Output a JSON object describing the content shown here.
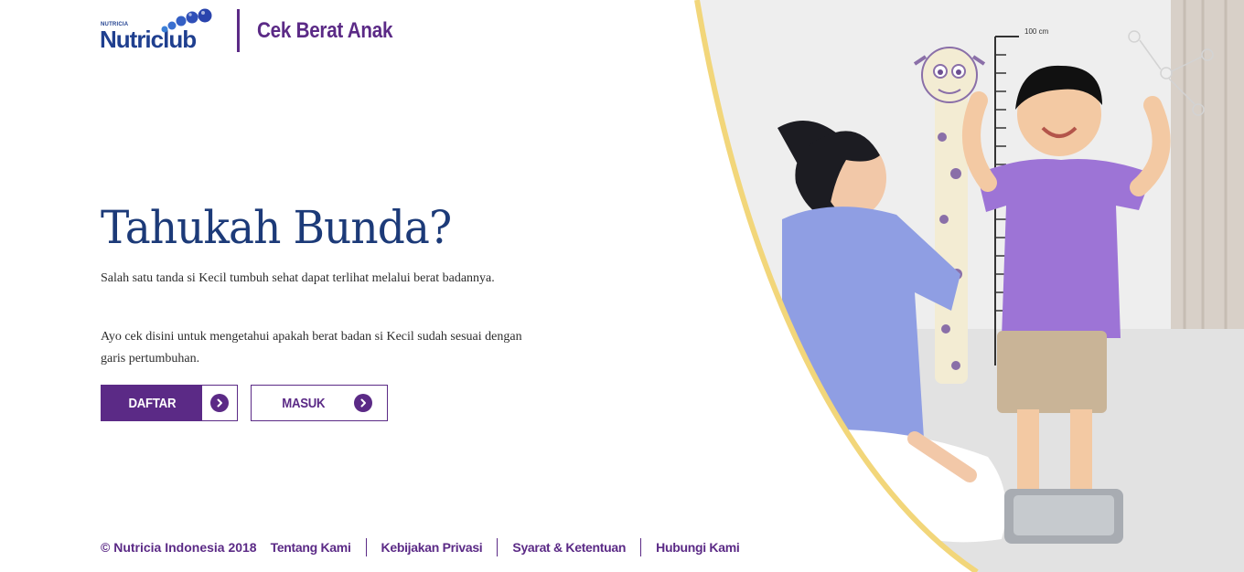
{
  "header": {
    "brand_small": "NUTRICIA",
    "brand_name": "Nutriclub",
    "title": "Cek Berat Anak"
  },
  "hero": {
    "headline": "Tahukah Bunda?",
    "paragraph_1": "Salah satu tanda si Kecil tumbuh sehat dapat terlihat melalui berat badannya.",
    "paragraph_2": "Ayo cek disini untuk mengetahui apakah berat badan si Kecil sudah sesuai dengan garis pertumbuhan."
  },
  "buttons": {
    "register_label": "DAFTAR",
    "login_label": "MASUK"
  },
  "photo": {
    "height_marker": "100 cm"
  },
  "footer": {
    "copyright": "© Nutricia Indonesia 2018",
    "links": [
      "Tentang Kami",
      "Kebijakan Privasi",
      "Syarat & Ketentuan",
      "Hubungi Kami"
    ]
  },
  "colors": {
    "brand_purple": "#5b2a86",
    "brand_navy": "#1c3a78",
    "accent_yellow": "#f2d67a"
  }
}
